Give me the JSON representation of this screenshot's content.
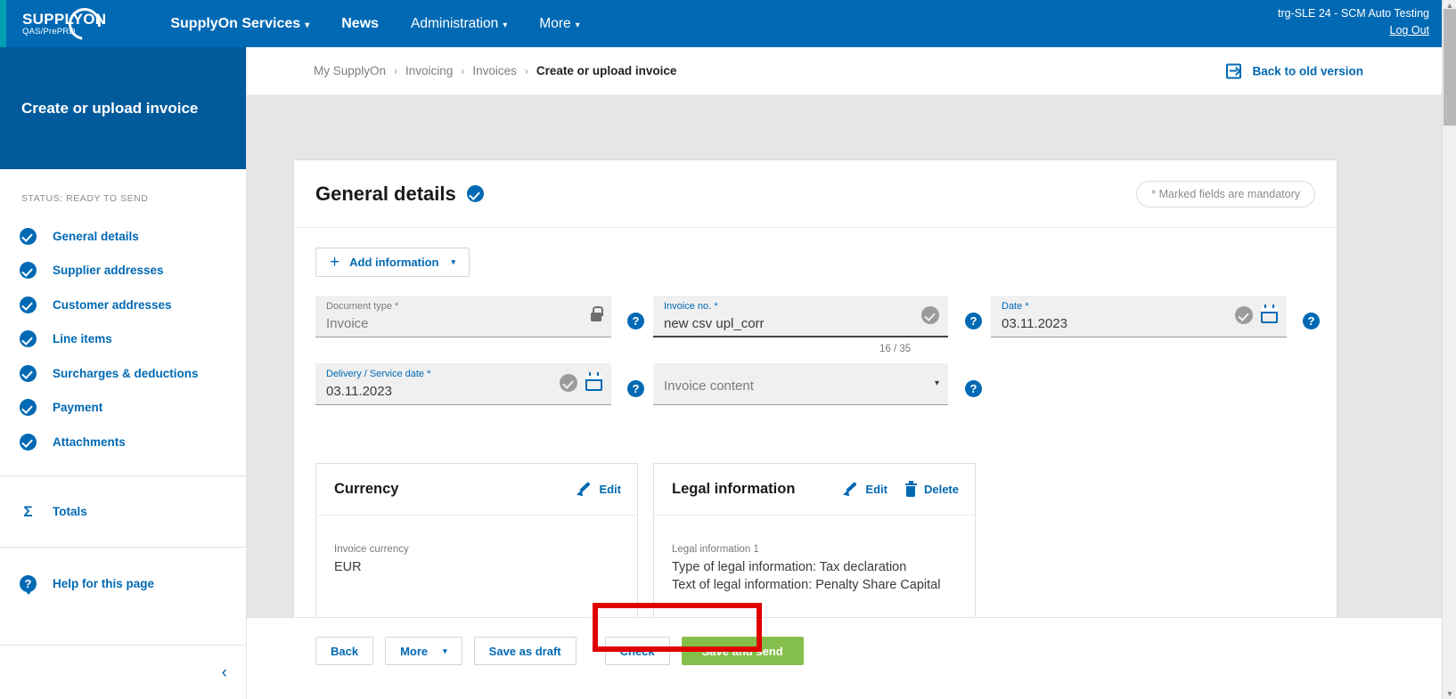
{
  "topnav": {
    "logo_main": "SUPPLYON",
    "logo_sub": "QAS/PrePRD",
    "items": [
      {
        "label": "SupplyOn Services",
        "caret": "▾",
        "bold": true
      },
      {
        "label": "News",
        "caret": "",
        "bold": true
      },
      {
        "label": "Administration",
        "caret": "▾",
        "bold": false
      },
      {
        "label": "More",
        "caret": "▾",
        "bold": false
      }
    ],
    "user": "trg-SLE 24 - SCM Auto Testing",
    "logout": "Log Out"
  },
  "sidebar": {
    "title": "Create or upload invoice",
    "status": "STATUS: READY TO SEND",
    "items": [
      {
        "label": "General details"
      },
      {
        "label": "Supplier addresses"
      },
      {
        "label": "Customer addresses"
      },
      {
        "label": "Line items"
      },
      {
        "label": "Surcharges & deductions"
      },
      {
        "label": "Payment"
      },
      {
        "label": "Attachments"
      }
    ],
    "totals": {
      "label": "Totals",
      "icon": "sigma-icon"
    },
    "help": {
      "label": "Help for this page",
      "icon": "question-icon"
    },
    "collapse_glyph": "‹"
  },
  "breadcrumb": {
    "items": [
      "My SupplyOn",
      "Invoicing",
      "Invoices",
      "Create or upload invoice"
    ],
    "separator": "›"
  },
  "back_to_old": {
    "label": "Back to old version",
    "icon": "export-arrow-icon"
  },
  "main": {
    "title": "General details",
    "mandatory_note": "* Marked fields are mandatory",
    "add_information": "Add information",
    "add_caret": "▾",
    "fields": {
      "document_type": {
        "label": "Document type",
        "star": "*",
        "value": "Invoice",
        "icon": "lock-icon"
      },
      "invoice_no": {
        "label": "Invoice no.",
        "star": "*",
        "value": "new csv upl_corr",
        "counter": "16 / 35"
      },
      "date": {
        "label": "Date",
        "star": "*",
        "value": "03.11.2023"
      },
      "delivery_service_date": {
        "label": "Delivery / Service date",
        "star": "*",
        "value": "03.11.2023"
      },
      "invoice_content": {
        "label": "Invoice content",
        "caret": "▾"
      }
    },
    "help_glyph": "?",
    "currency_card": {
      "title": "Currency",
      "edit": "Edit",
      "label": "Invoice currency",
      "value": "EUR"
    },
    "legal_card": {
      "title": "Legal information",
      "edit": "Edit",
      "delete": "Delete",
      "label": "Legal information 1",
      "line1": "Type of legal information: Tax declaration",
      "line2": "Text of legal information: Penalty Share Capital"
    }
  },
  "footer": {
    "buttons": [
      {
        "label": "Back",
        "style": "default",
        "caret": ""
      },
      {
        "label": "More",
        "style": "default",
        "caret": "▾"
      },
      {
        "label": "Save as draft",
        "style": "default",
        "caret": ""
      },
      {
        "label": "Check",
        "style": "default",
        "caret": ""
      },
      {
        "label": "Save and send",
        "style": "green",
        "caret": ""
      }
    ]
  },
  "colors": {
    "brand_blue": "#0069b4",
    "sidebar_blue": "#005a9c",
    "teal": "#00a1b3",
    "green": "#85bf4b",
    "highlight_red": "#e00000"
  },
  "scrollbar": {
    "up": "▲",
    "down": "▼"
  }
}
